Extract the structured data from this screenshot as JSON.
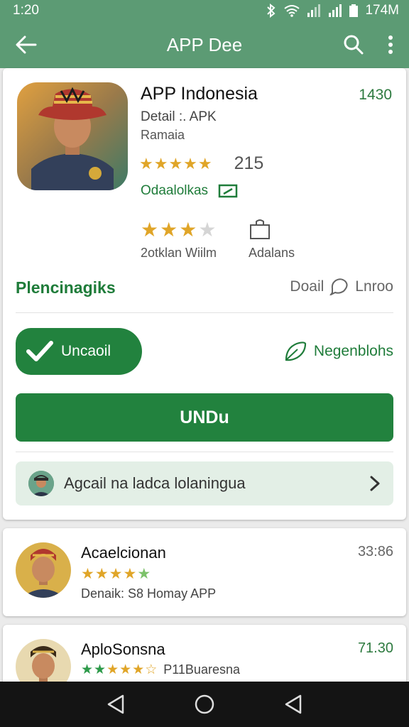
{
  "status_bar": {
    "time": "1:20",
    "battery_text": "174M"
  },
  "app_bar": {
    "title": "APP Dee"
  },
  "app": {
    "title": "APP Indonesia",
    "count": "1430",
    "subtitle1": "Detail :. APK",
    "subtitle2": "Ramaia",
    "stars": "★★★★★",
    "rating_count": "215",
    "link_label": "Odaalolkas"
  },
  "meta": {
    "item1_label": "2otklan Wiilm",
    "item2_label": "Adalans"
  },
  "section": {
    "title": "Plencinagiks",
    "right_label": "Doail",
    "right_action": "Lnroo"
  },
  "actions": {
    "installed_label": "Uncaoil",
    "share_label": "Negenblohs",
    "primary_label": "UNDu"
  },
  "banner": {
    "text": "Agcail na ladca lolaningua"
  },
  "list": [
    {
      "title": "Acaelcionan",
      "value": "33:86",
      "stars": "★★★★★",
      "subtitle": "Denaik: S8 Homay APP"
    },
    {
      "title": "AploSonsna",
      "value": "71.30",
      "stars": "★★★★☆",
      "subtitle": "P11Buaresna"
    }
  ],
  "colors": {
    "primary": "#5c9b74",
    "accent": "#22823e",
    "star": "#e0a528"
  }
}
